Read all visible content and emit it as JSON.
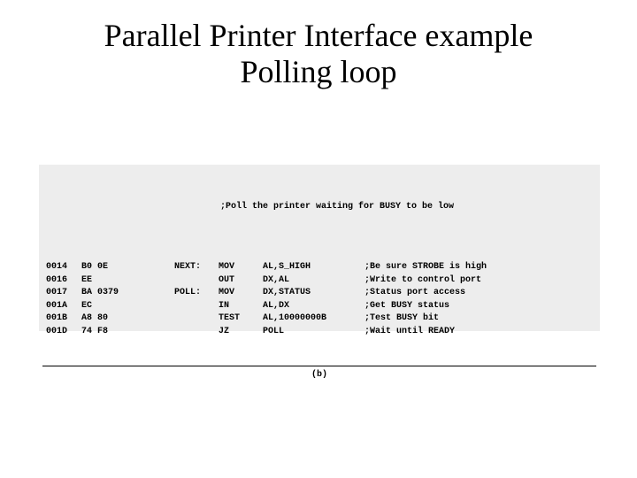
{
  "title_line1": "Parallel Printer Interface example",
  "title_line2": "Polling loop",
  "code_caption": ";Poll the printer waiting for BUSY to be low",
  "figure_label": "(b)",
  "rows": [
    {
      "addr": "0014",
      "hex": "B0 0E",
      "label": "NEXT:",
      "mnem": "MOV",
      "ops": "AL,S_HIGH",
      "cmt": ";Be sure STROBE is high"
    },
    {
      "addr": "0016",
      "hex": "EE",
      "label": "",
      "mnem": "OUT",
      "ops": "DX,AL",
      "cmt": ";Write to control port"
    },
    {
      "addr": "0017",
      "hex": "BA 0379",
      "label": "POLL:",
      "mnem": "MOV",
      "ops": "DX,STATUS",
      "cmt": ";Status port access"
    },
    {
      "addr": "001A",
      "hex": "EC",
      "label": "",
      "mnem": "IN",
      "ops": "AL,DX",
      "cmt": ";Get BUSY status"
    },
    {
      "addr": "001B",
      "hex": "A8 80",
      "label": "",
      "mnem": "TEST",
      "ops": "AL,10000000B",
      "cmt": ";Test BUSY bit"
    },
    {
      "addr": "001D",
      "hex": "74 F8",
      "label": "",
      "mnem": "JZ",
      "ops": "POLL",
      "cmt": ";Wait until READY"
    }
  ]
}
